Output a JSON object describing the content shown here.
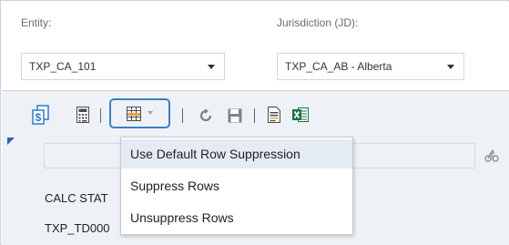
{
  "entity": {
    "label": "Entity:",
    "value": "TXP_CA_101"
  },
  "jurisdiction": {
    "label": "Jurisdiction (JD):",
    "value": "TXP_CA_AB - Alberta"
  },
  "grid": {
    "rows": [
      {
        "label": "CALC STAT"
      },
      {
        "label": "TXP_TD000"
      }
    ]
  },
  "row_suppression_menu": {
    "items": [
      {
        "label": "Use Default Row Suppression",
        "highlighted": true
      },
      {
        "label": "Suppress Rows",
        "highlighted": false
      },
      {
        "label": "Unsuppress Rows",
        "highlighted": false
      }
    ]
  },
  "colors": {
    "focus_border": "#3b7fc4",
    "panel_bg": "#eef2f6",
    "menu_highlight": "#e4ebf5",
    "currency_icon_blue": "#2b7bc9",
    "excel_green": "#1e7145",
    "row_band_orange": "#e8a33c"
  },
  "icons": {
    "currency": "currency-exchange-icon",
    "calculator": "calculator-icon",
    "row_suppression": "row-suppression-icon",
    "refresh": "refresh-icon",
    "save": "save-icon",
    "report": "report-document-icon",
    "excel": "excel-export-icon",
    "cycle": "bicycle-icon"
  }
}
